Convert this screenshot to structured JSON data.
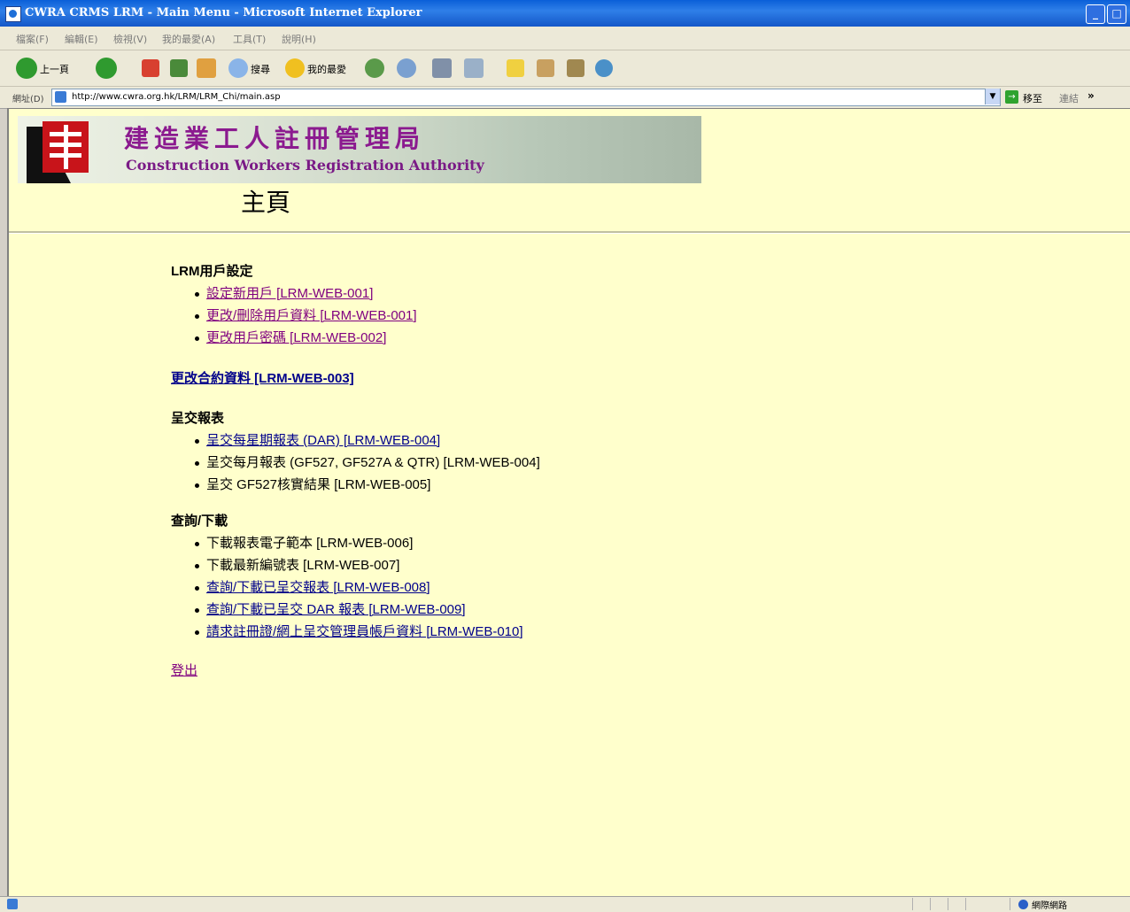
{
  "window": {
    "title": "CWRA CRMS LRM - Main Menu - Microsoft Internet Explorer"
  },
  "menubar": [
    "檔案(F)",
    "編輯(E)",
    "檢視(V)",
    "我的最愛(A)",
    "工具(T)",
    "說明(H)"
  ],
  "toolbar": {
    "back_label": "上一頁",
    "search_label": "搜尋",
    "favorites_label": "我的最愛"
  },
  "address": {
    "label": "網址(D)",
    "url": "http://www.cwra.org.hk/LRM/LRM_Chi/main.asp",
    "go_label": "移至",
    "links_label": "連結"
  },
  "banner": {
    "chinese": "建造業工人註冊管理局",
    "english": "Construction Workers Registration Authority"
  },
  "page": {
    "title": "主頁"
  },
  "sections": {
    "user_settings": {
      "heading": "LRM用戶設定",
      "items": [
        "設定新用戶  [LRM-WEB-001]",
        "更改/刪除用戶資料  [LRM-WEB-001]",
        "更改用戶密碼  [LRM-WEB-002]"
      ]
    },
    "contract": {
      "link": "更改合約資料  [LRM-WEB-003]"
    },
    "submit": {
      "heading": "呈交報表",
      "items": [
        "呈交每星期報表 (DAR) [LRM-WEB-004]",
        "呈交每月報表 (GF527, GF527A & QTR) [LRM-WEB-004]",
        "呈交 GF527核實結果 [LRM-WEB-005]"
      ]
    },
    "query": {
      "heading": "查詢/下載",
      "items": [
        "下載報表電子範本 [LRM-WEB-006]",
        "下載最新編號表 [LRM-WEB-007]",
        "查詢/下載已呈交報表  [LRM-WEB-008]",
        "查詢/下載已呈交 DAR 報表  [LRM-WEB-009]",
        "請求註冊證/網上呈交管理員帳戶資料  [LRM-WEB-010]"
      ]
    },
    "logout": "登出"
  },
  "statusbar": {
    "zone": "網際網路"
  },
  "colors": {
    "page_bg": "#ffffcc",
    "link": "#00008b",
    "visited": "#800080",
    "banner_text": "#8b1a8f"
  }
}
